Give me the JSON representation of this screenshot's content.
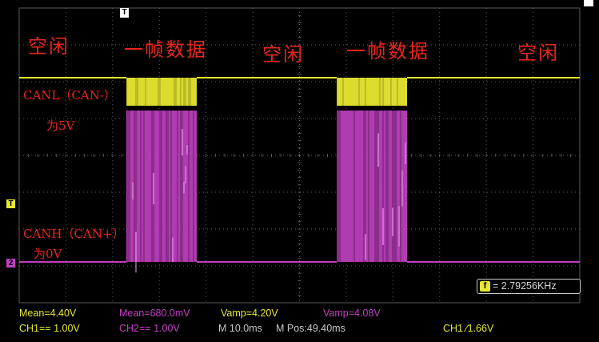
{
  "annotations": {
    "idle_1": "空闲",
    "frame_1": "一帧数据",
    "idle_2": "空闲",
    "frame_2": "一帧数据",
    "idle_3": "空闲",
    "canl_label": "CANL（CAN-）",
    "canl_level": "为5V",
    "canh_label": "CANH（CAN+）",
    "canh_level": "为0V"
  },
  "measurements": {
    "ch1_mean": "Mean=4.40V",
    "ch2_mean": "Mean=680.0mV",
    "ch1_vamp": "Vamp=4.20V",
    "ch2_vamp": "Vamp=4.08V"
  },
  "status_bar": {
    "ch1_scale": "CH1== 1.00V",
    "ch2_scale": "CH2== 1.00V",
    "timebase": "M 10.0ms",
    "position": "M Pos:49.40ms",
    "trigger": "CH1 ∕1.66V"
  },
  "frequency_counter": {
    "icon": "f",
    "value": "= 2.79256KHz"
  },
  "markers": {
    "trigger_position": "T",
    "trigger_level": "T",
    "ch2_ground": "2"
  },
  "colors": {
    "ch1": "#e8e830",
    "ch2": "#c040c0",
    "annotation": "#e8261c",
    "grid": "#5a5a5a"
  }
}
